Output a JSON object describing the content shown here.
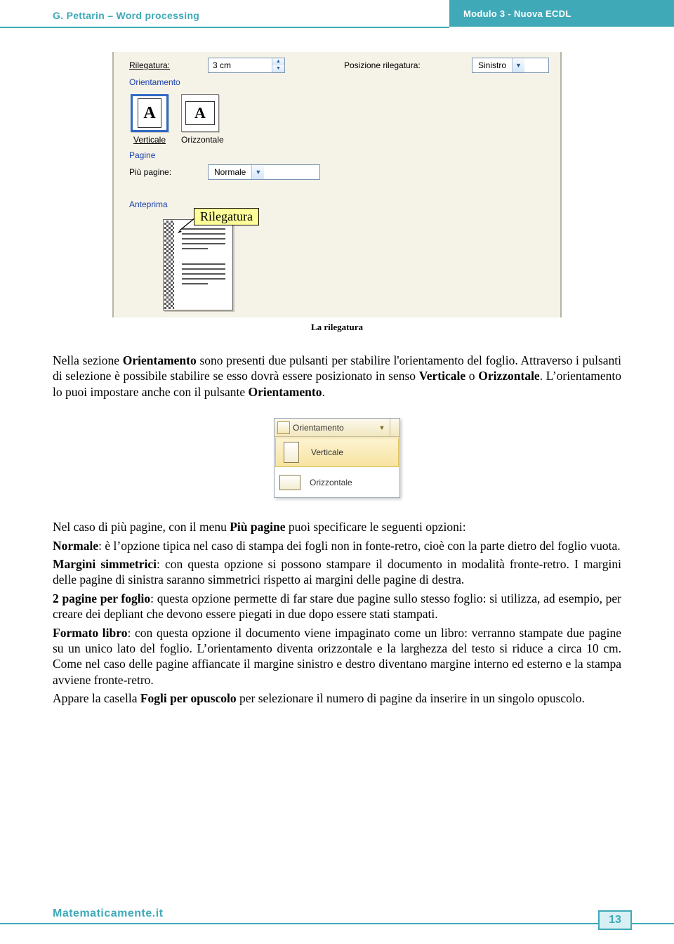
{
  "header": {
    "left": "G. Pettarin – Word processing",
    "right": "Modulo 3 - Nuova ECDL"
  },
  "footer": {
    "site": "Matematicamente.it",
    "page": "13"
  },
  "dialog": {
    "rilegatura_label": "Rilegatura:",
    "rilegatura_value": "3 cm",
    "posizione_label": "Posizione rilegatura:",
    "posizione_value": "Sinistro",
    "sect_orient": "Orientamento",
    "orient_v": "Verticale",
    "orient_h": "Orizzontale",
    "orient_glyph": "A",
    "sect_pagine": "Pagine",
    "piu_pagine_label": "Più pagine:",
    "piu_pagine_value": "Normale",
    "anteprima_label": "Anteprima",
    "callout": "Rilegatura"
  },
  "caption1": "La rilegatura",
  "body": {
    "p1_a": "Nella sezione ",
    "p1_b": "Orientamento",
    "p1_c": " sono presenti due pulsanti per stabilire l'orientamento del foglio. Attraverso i pulsanti di selezione è possibile stabilire se esso dovrà essere posizionato in senso ",
    "p1_d": "Verticale",
    "p1_e": " o ",
    "p1_f": "Orizzontale",
    "p1_g": ". L’orientamento lo puoi impostare anche con il pulsante ",
    "p1_h": "Orientamento",
    "p1_i": ".",
    "p2_a": "Nel caso di più pagine, con il menu ",
    "p2_b": "Più pagine",
    "p2_c": " puoi specificare le seguenti opzioni:",
    "p3_a": "Normale",
    "p3_b": ": è l’opzione tipica nel caso di stampa dei fogli non in fonte-retro, cioè con la parte dietro del foglio vuota.",
    "p4_a": "Margini simmetrici",
    "p4_b": ": con questa opzione si possono stampare il documento in modalità fronte-retro.  I margini delle pagine di sinistra saranno simmetrici rispetto ai margini delle pagine di destra.",
    "p5_a": "2 pagine per foglio",
    "p5_b": ": questa opzione permette di far stare due pagine sullo stesso foglio: si utilizza, ad esempio, per creare dei depliant che devono essere piegati in due dopo essere stati stampati.",
    "p6_a": "Formato libro",
    "p6_b": ": con questa opzione il documento viene impaginato come un libro: verranno stampate due pagine su un unico lato del foglio. L’orientamento diventa orizzontale e la larghezza del testo si riduce a circa 10 cm. Come nel caso delle pagine affiancate il margine sinistro e destro diventano margine interno ed esterno e la stampa avviene fronte-retro.",
    "p7_a": "Appare la casella ",
    "p7_b": "Fogli per opuscolo",
    "p7_c": " per selezionare il numero di pagine da inserire in un singolo opuscolo."
  },
  "menu": {
    "head": "Orientamento",
    "v": "Verticale",
    "h": "Orizzontale"
  }
}
